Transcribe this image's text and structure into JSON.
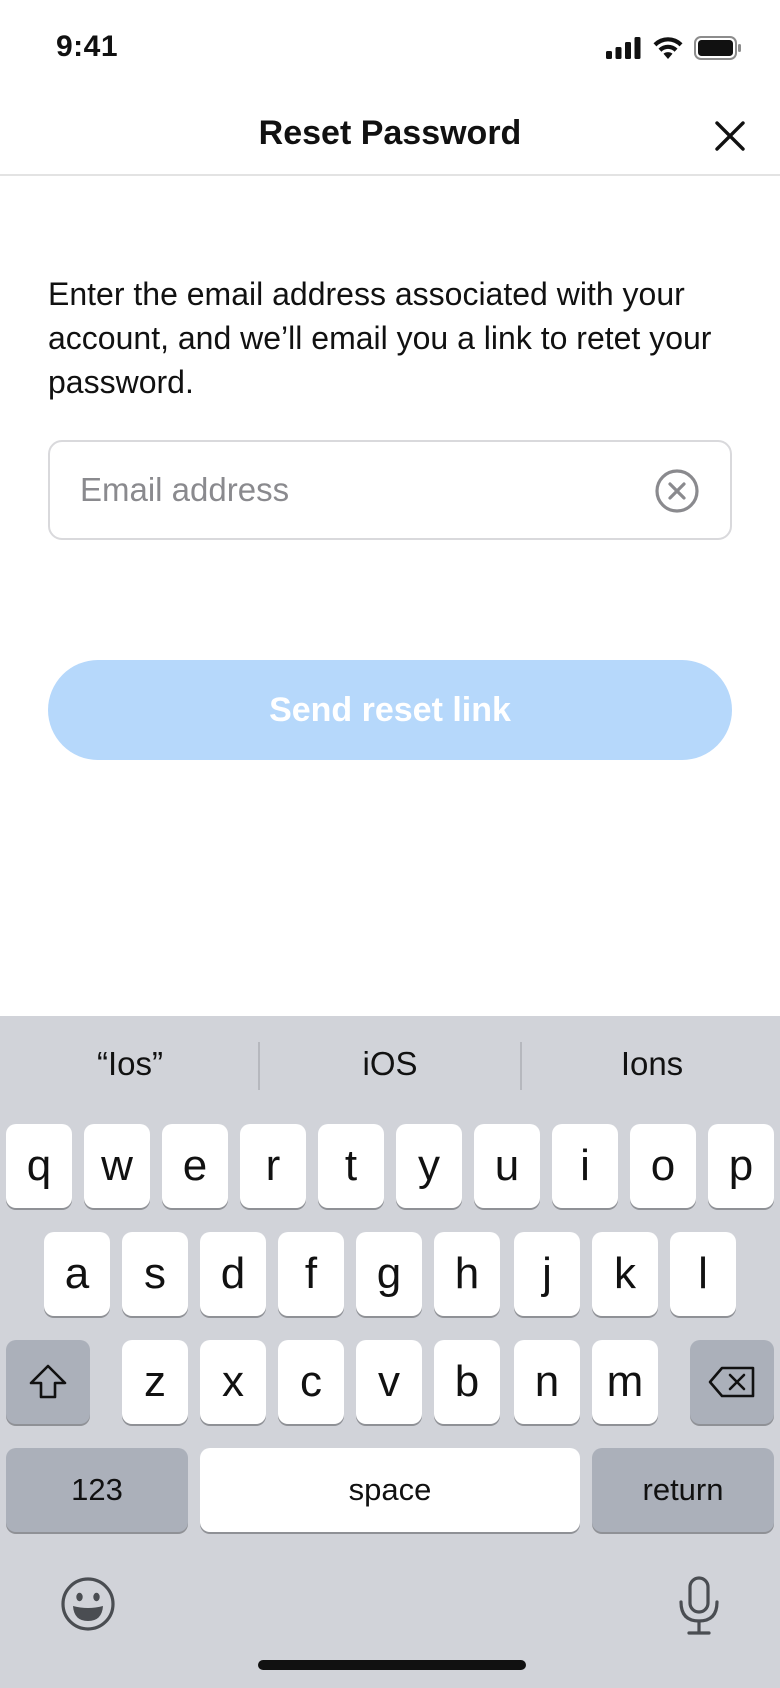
{
  "status_bar": {
    "time": "9:41",
    "icons": [
      "signal-icon",
      "wifi-icon",
      "battery-icon"
    ]
  },
  "nav": {
    "title": "Reset Password",
    "close_icon": "close-icon"
  },
  "content": {
    "instructions": "Enter the email address associated with your account, and we’ll email you a link to retet your password.",
    "email_value": "",
    "email_placeholder": "Email address",
    "clear_icon": "clear-circle-x-icon",
    "send_button": "Send reset link"
  },
  "colors": {
    "primary_disabled": "#b6d8fb",
    "keyboard_bg": "#d1d3d9",
    "key_dark": "#abb0ba"
  },
  "keyboard": {
    "suggestions": [
      "“Ios”",
      "iOS",
      "Ions"
    ],
    "row1": [
      "q",
      "w",
      "e",
      "r",
      "t",
      "y",
      "u",
      "i",
      "o",
      "p"
    ],
    "row2": [
      "a",
      "s",
      "d",
      "f",
      "g",
      "h",
      "j",
      "k",
      "l"
    ],
    "row3": [
      "z",
      "x",
      "c",
      "v",
      "b",
      "n",
      "m"
    ],
    "shift_icon": "shift-icon",
    "delete_icon": "backspace-icon",
    "numbers_key": "123",
    "space_key": "space",
    "return_key": "return",
    "emoji_icon": "emoji-icon",
    "mic_icon": "microphone-icon"
  }
}
